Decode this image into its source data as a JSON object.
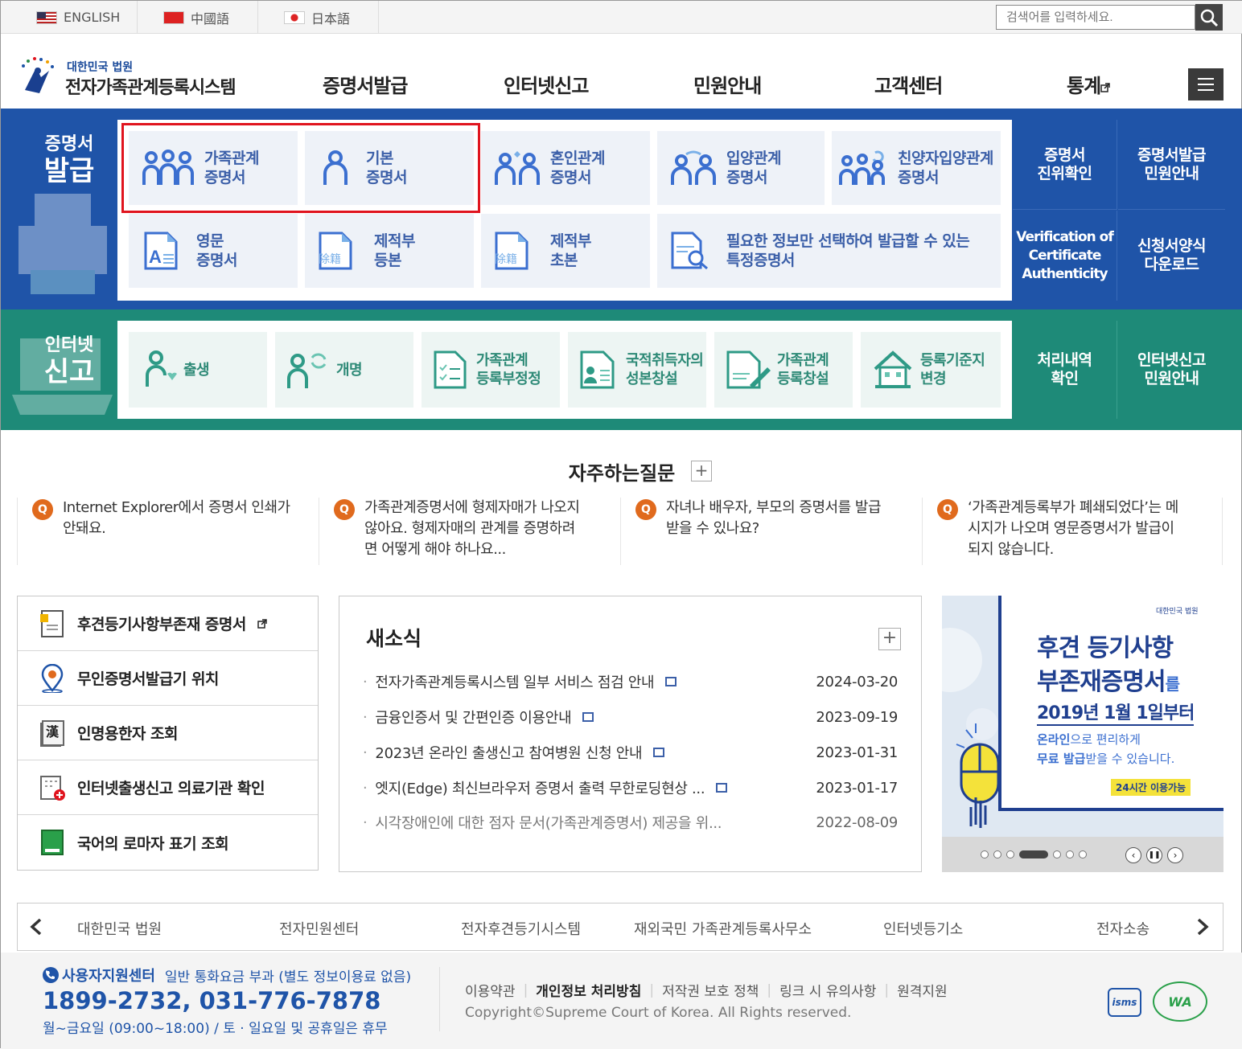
{
  "lang": {
    "english": "ENGLISH",
    "chinese": "中國語",
    "japanese": "日本語"
  },
  "search": {
    "placeholder": "검색어를 입력하세요."
  },
  "logo": {
    "sub": "대한민국 법원",
    "title": "전자가족관계등록시스템"
  },
  "gnb": [
    "증명서발급",
    "인터넷신고",
    "민원안내",
    "고객센터",
    "통계"
  ],
  "cert": {
    "side_small": "증명서",
    "side_big": "발급",
    "cards": [
      {
        "l1": "가족관계",
        "l2": "증명서",
        "icon": "family-icon"
      },
      {
        "l1": "기본",
        "l2": "증명서",
        "icon": "person-icon"
      },
      {
        "l1": "혼인관계",
        "l2": "증명서",
        "icon": "marriage-icon"
      },
      {
        "l1": "입양관계",
        "l2": "증명서",
        "icon": "adoption-icon"
      },
      {
        "l1": "친양자입양관계",
        "l2": "증명서",
        "icon": "full-adoption-icon"
      },
      {
        "l1": "영문",
        "l2": "증명서",
        "icon": "english-doc-icon"
      },
      {
        "l1": "제적부",
        "l2": "등본",
        "icon": "removed-register-copy-icon"
      },
      {
        "l1": "제적부",
        "l2": "초본",
        "icon": "removed-register-extract-icon"
      },
      {
        "l1": "필요한 정보만 선택하여 발급할 수 있는",
        "l2": "특정증명서",
        "icon": "search-doc-icon"
      }
    ],
    "side_buttons": [
      {
        "l1": "증명서",
        "l2": "진위확인"
      },
      {
        "l1": "증명서발급",
        "l2": "민원안내"
      },
      {
        "l1": "Verification of",
        "l2": "Certificate",
        "l3": "Authenticity"
      },
      {
        "l1": "신청서양식",
        "l2": "다운로드"
      }
    ],
    "doc_stamp": "除籍"
  },
  "report": {
    "side_small": "인터넷",
    "side_big": "신고",
    "cards": [
      {
        "l1": "출생",
        "icon": "birth-icon"
      },
      {
        "l1": "개명",
        "icon": "name-change-icon"
      },
      {
        "l1": "가족관계",
        "l2": "등록부정정",
        "icon": "correction-icon"
      },
      {
        "l1": "국적취득자의",
        "l2": "성본창설",
        "icon": "naturalization-icon"
      },
      {
        "l1": "가족관계",
        "l2": "등록창설",
        "icon": "register-create-icon"
      },
      {
        "l1": "등록기준지",
        "l2": "변경",
        "icon": "house-icon"
      }
    ],
    "side_buttons": [
      {
        "l1": "처리내역",
        "l2": "확인"
      },
      {
        "l1": "인터넷신고",
        "l2": "민원안내"
      }
    ]
  },
  "faq": {
    "title": "자주하는질문",
    "items": [
      {
        "l1": "Internet Explorer에서 증명서 인쇄가",
        "l2": "안돼요.",
        "l3": ""
      },
      {
        "l1": "가족관계증명서에 형제자매가 나오지",
        "l2": "않아요. 형제자매의 관계를 증명하려",
        "l3": "면 어떻게 해야 하나요..."
      },
      {
        "l1": "자녀나 배우자, 부모의 증명서를 발급",
        "l2": "받을 수 있나요?",
        "l3": ""
      },
      {
        "l1": "‘가족관계등록부가 폐쇄되었다’는 메",
        "l2": "시지가 나오며 영문증명서가 발급이",
        "l3": "되지 않습니다."
      }
    ]
  },
  "quick": [
    {
      "label": "후견등기사항부존재 증명서",
      "icon": "document-icon"
    },
    {
      "label": "무인증명서발급기 위치",
      "icon": "location-pin-icon"
    },
    {
      "label": "인명용한자 조회",
      "icon": "hanja-book-icon"
    },
    {
      "label": "인터넷출생신고 의료기관 확인",
      "icon": "hospital-icon"
    },
    {
      "label": "국어의 로마자 표기 조회",
      "icon": "green-book-icon"
    }
  ],
  "news": {
    "title": "새소식",
    "items": [
      {
        "title": "전자가족관계등록시스템 일부 서비스 점검 안내",
        "date": "2024-03-20"
      },
      {
        "title": "금융인증서 및 간편인증 이용안내",
        "date": "2023-09-19"
      },
      {
        "title": "2023년 온라인 출생신고 참여병원 신청 안내",
        "date": "2023-01-31"
      },
      {
        "title": "엣지(Edge) 최신브라우저 증명서 출력 무한로딩현상 ...",
        "date": "2023-01-17"
      },
      {
        "title": "시각장애인에 대한 점자 문서(가족관계증명서) 제공을 위...",
        "date": "2022-08-09"
      }
    ]
  },
  "banner": {
    "brand": "대한민국 법원",
    "line1": "후견 등기사항",
    "line2": "부존재증명서",
    "line2_suffix": "를",
    "line3": "2019년 1월 1일부터",
    "line4a": "온라인",
    "line4b": "으로 편리하게",
    "line5a": "무료 발급",
    "line5b": "받을 수 있습니다.",
    "badge": "24시간 이용가능"
  },
  "sites": [
    "대한민국 법원",
    "전자민원센터",
    "전자후견등기시스템",
    "재외국민 가족관계등록사무소",
    "인터넷등기소",
    "전자소송"
  ],
  "footer": {
    "center": "사용자지원센터",
    "fee": "일반 통화요금 부과 (별도 정보이용료 없음)",
    "phone": "1899-2732, 031-776-7878",
    "hours": "월~금요일 (09:00~18:00) / 토 · 일요일 및 공휴일은 휴무",
    "links": [
      "이용약관",
      "개인정보 처리방침",
      "저작권 보호 정책",
      "링크 시 유의사항",
      "원격지원"
    ],
    "copyright": "Copyright©Supreme Court of Korea. All Rights reserved.",
    "badge1": "isms",
    "badge2": "WA"
  },
  "colors": {
    "blue": "#1f54a8",
    "green": "#1e8a78",
    "highlight": "#e0141e",
    "orange": "#e06a1d"
  }
}
